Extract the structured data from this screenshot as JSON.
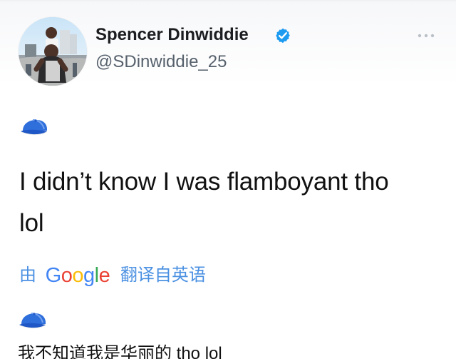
{
  "profile": {
    "display_name": "Spencer Dinwiddie",
    "handle": "@SDinwiddie_25",
    "avatar_icon": "avatar-photo",
    "verified_icon": "verified-badge-icon",
    "more_icon": "more-options-icon"
  },
  "tweet": {
    "emoji_icon": "blue-cap-icon",
    "text_line_1": "I didn’t know I was flamboyant tho",
    "text_line_2": "lol"
  },
  "translation": {
    "by_label": "由",
    "provider_logo": [
      "G",
      "o",
      "o",
      "g",
      "l",
      "e"
    ],
    "action_label": "翻译自英语",
    "translated_emoji_icon": "blue-cap-icon",
    "translated_text": "我不知道我是华丽的 tho lol"
  },
  "colors": {
    "accent_blue": "#4a90e2",
    "google_blue": "#4285f4",
    "google_red": "#ea4335",
    "google_yellow": "#fbbc05",
    "google_green": "#34a853",
    "verified_blue": "#1d9bf0",
    "cap_blue": "#2f6fdb"
  }
}
